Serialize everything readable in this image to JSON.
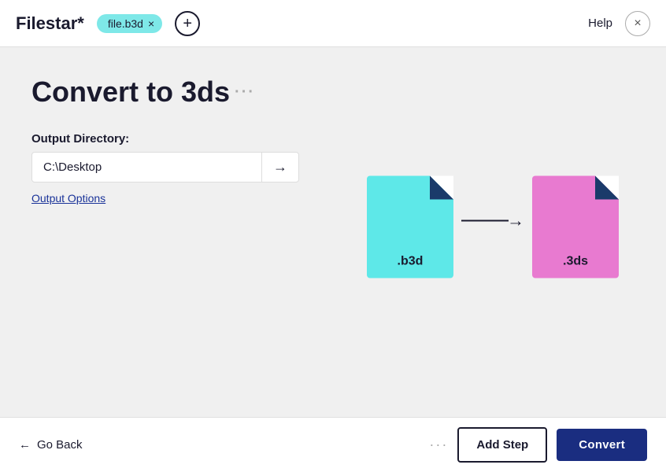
{
  "app": {
    "title": "Filestar",
    "star": "*"
  },
  "file_tag": {
    "label": "file.b3d",
    "close": "×"
  },
  "add_file_btn": "+",
  "header": {
    "help_label": "Help",
    "close_label": "×"
  },
  "main": {
    "page_title": "Convert to 3ds",
    "title_dots": "···",
    "output_directory_label": "Output Directory:",
    "output_directory_value": "C:\\Desktop",
    "output_directory_placeholder": "C:\\Desktop",
    "output_options_label": "Output Options",
    "dir_arrow": "→"
  },
  "illustration": {
    "source_ext": ".b3d",
    "target_ext": ".3ds"
  },
  "footer": {
    "go_back_label": "Go Back",
    "more_dots": "···",
    "add_step_label": "Add Step",
    "convert_label": "Convert"
  }
}
